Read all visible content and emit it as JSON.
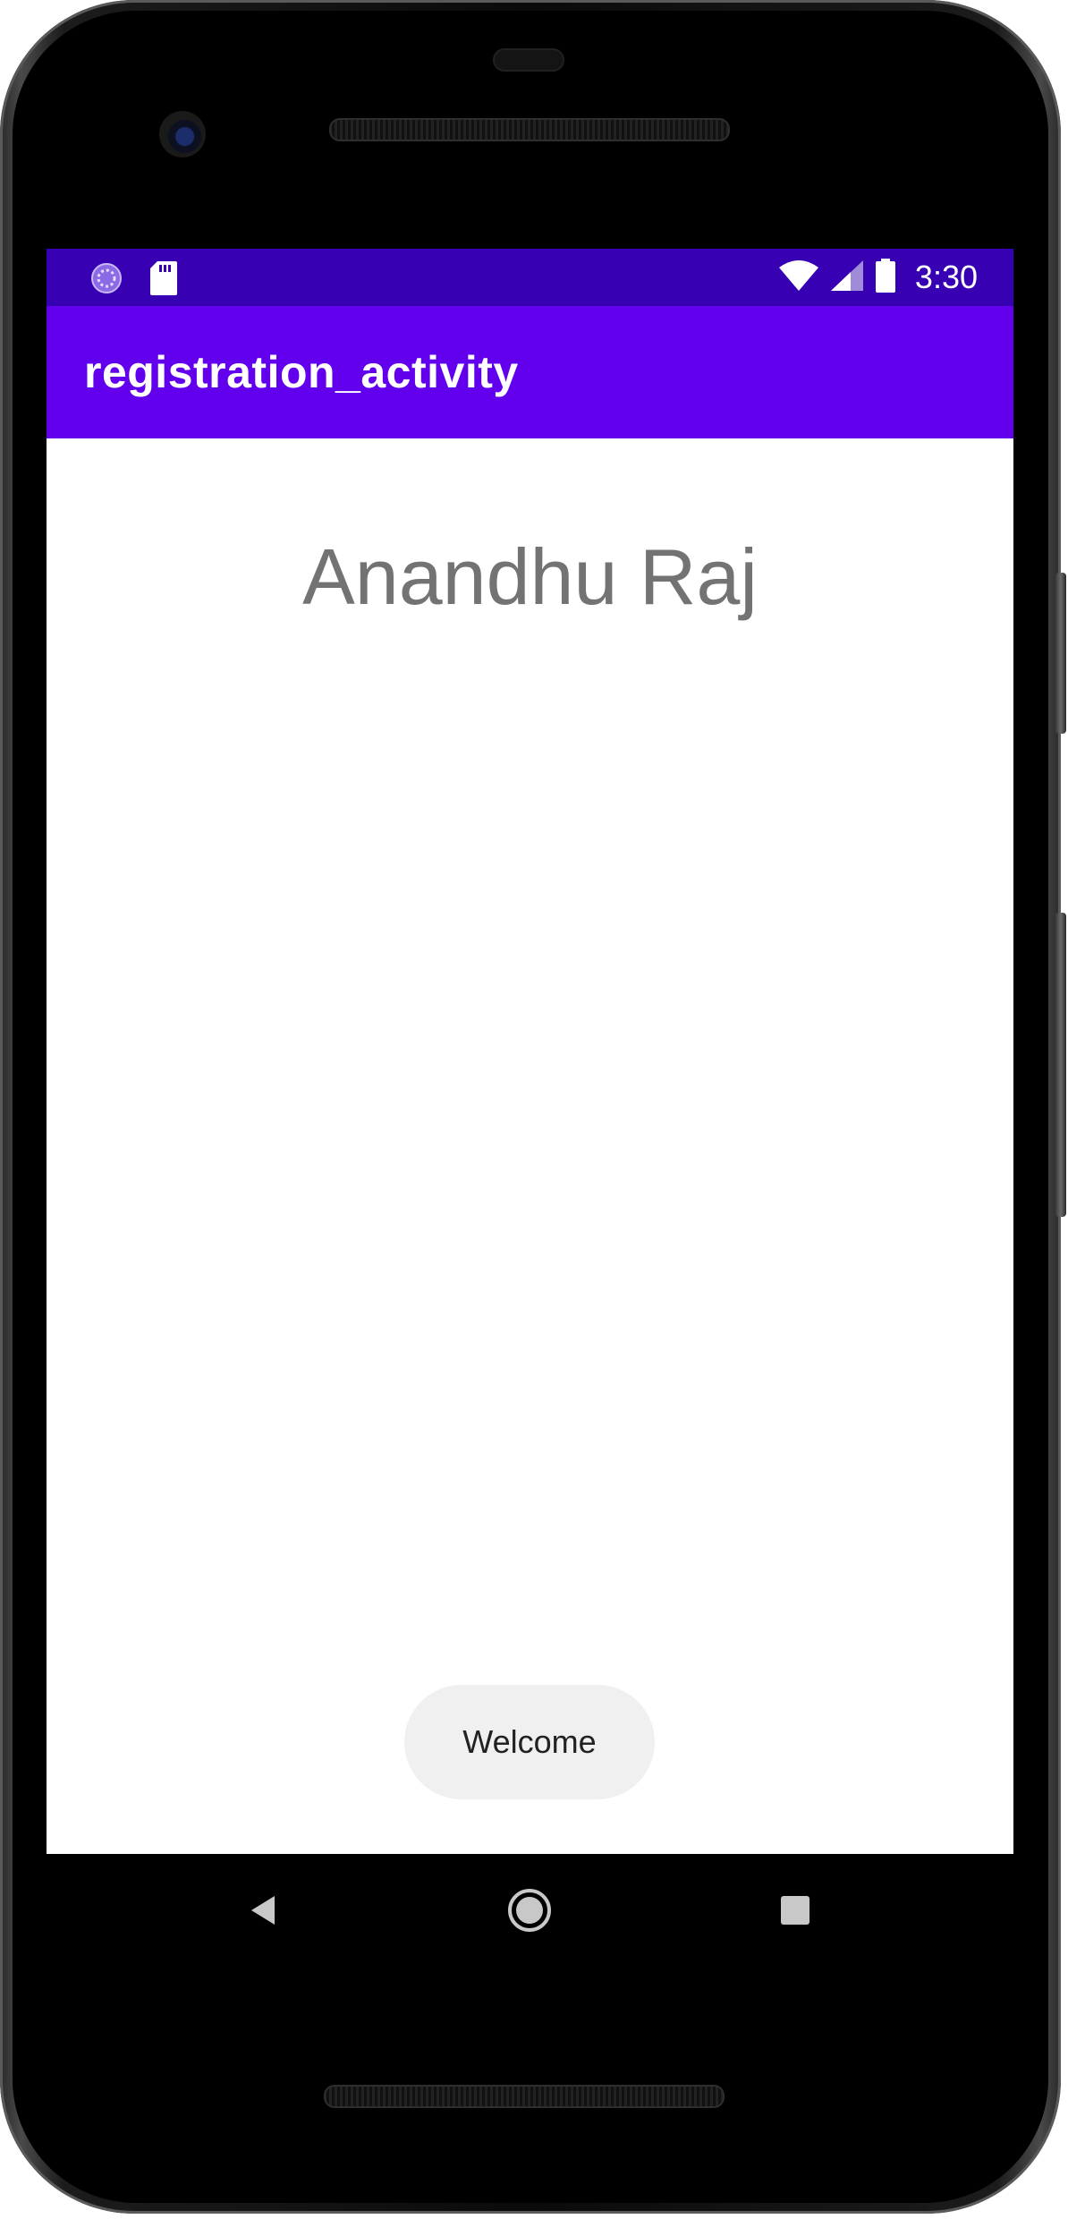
{
  "status_bar": {
    "time": "3:30",
    "left_icons": [
      "progress-spinner-icon",
      "sd-card-icon"
    ],
    "right_icons": [
      "wifi-icon",
      "cell-signal-icon",
      "battery-icon"
    ],
    "background_color": "#3700b3"
  },
  "app_bar": {
    "title": "registration_activity",
    "background_color": "#6200ee"
  },
  "main": {
    "name_text": "Anandhu Raj"
  },
  "toast": {
    "message": "Welcome"
  },
  "nav_bar": {
    "buttons": [
      "back-icon",
      "home-icon",
      "recents-icon"
    ]
  }
}
